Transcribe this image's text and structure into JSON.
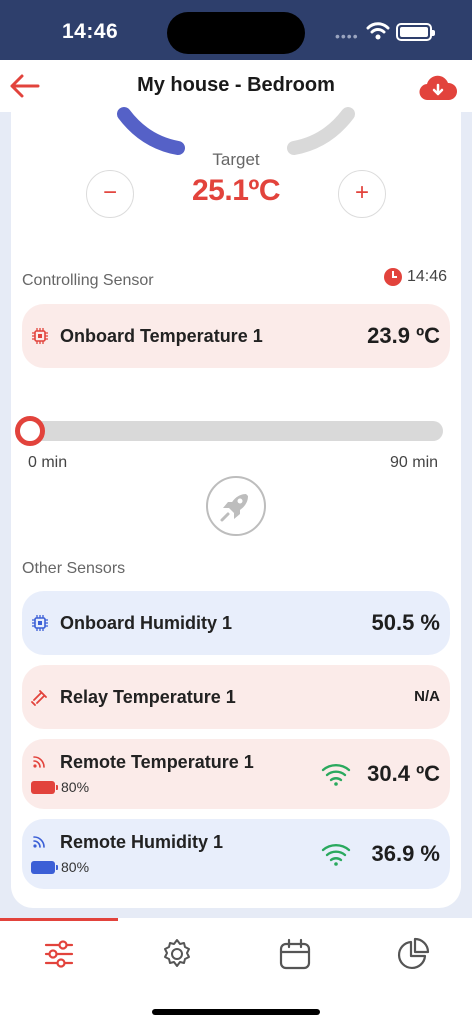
{
  "status_bar": {
    "time": "14:46"
  },
  "header": {
    "title": "My house - Bedroom"
  },
  "thermostat": {
    "target_label": "Target",
    "target_value": "25.1ºC",
    "minus_label": "−",
    "plus_label": "+"
  },
  "controlling": {
    "section_label": "Controlling Sensor",
    "time": "14:46",
    "sensor": {
      "name": "Onboard Temperature 1",
      "value": "23.9 ºC"
    }
  },
  "boost": {
    "min_label": "0 min",
    "max_label": "90 min",
    "level_percent": 0
  },
  "other": {
    "section_label": "Other Sensors",
    "sensors": [
      {
        "name": "Onboard Humidity 1",
        "value": "50.5 %"
      },
      {
        "name": "Relay Temperature 1",
        "value": "N/A"
      },
      {
        "name": "Remote Temperature 1",
        "value": "30.4 ºC",
        "battery": "80%"
      },
      {
        "name": "Remote Humidity 1",
        "value": "36.9 %",
        "battery": "80%"
      }
    ]
  },
  "colors": {
    "accent": "#e2433c",
    "navy": "#2e3f6c",
    "blue": "#3b5fd6",
    "green": "#2aa95e"
  },
  "tabs": [
    "sliders-icon",
    "gear-icon",
    "calendar-icon",
    "pie-chart-icon"
  ]
}
